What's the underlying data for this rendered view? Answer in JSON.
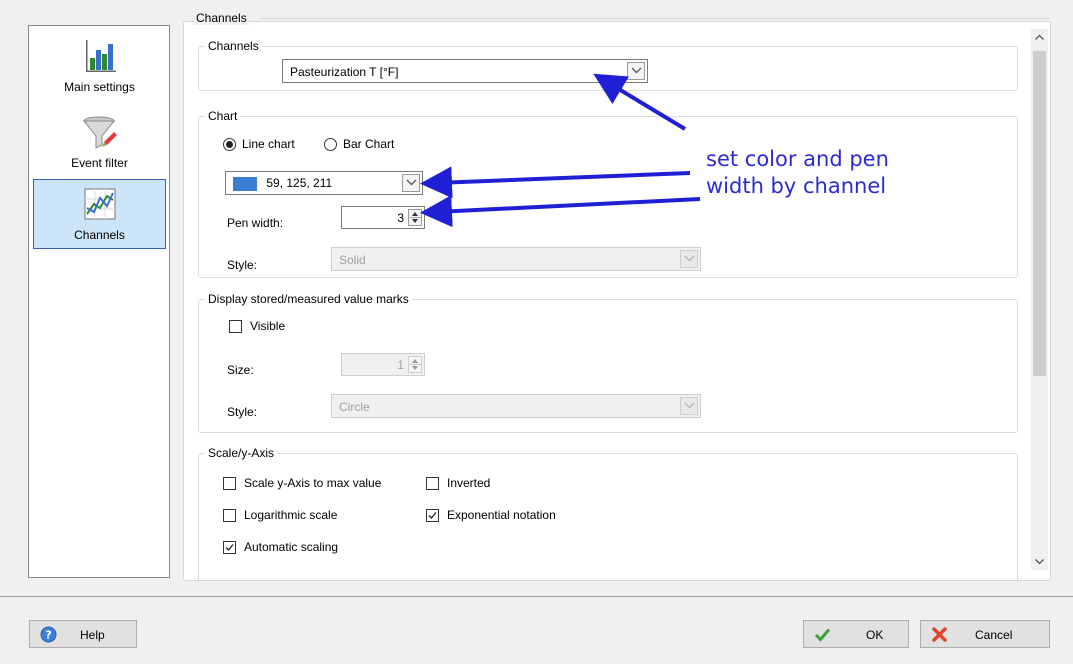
{
  "sidebar": {
    "items": [
      {
        "label": "Main settings",
        "icon": "bar-chart-icon"
      },
      {
        "label": "Event filter",
        "icon": "funnel-icon"
      },
      {
        "label": "Channels",
        "icon": "line-chart-icon",
        "selected": true
      }
    ]
  },
  "page": {
    "title": "Channels"
  },
  "channels_group": {
    "title": "Channels",
    "selected_channel": "Pasteurization T [°F]"
  },
  "chart_group": {
    "title": "Chart",
    "line_chart_label": "Line chart",
    "bar_chart_label": "Bar Chart",
    "line_chart_selected": true,
    "color_value": "59, 125, 211",
    "color_hex": "#3b7dd3",
    "pen_width_label": "Pen width:",
    "pen_width_value": "3",
    "style_label": "Style:",
    "style_value": "Solid"
  },
  "marks_group": {
    "title": "Display stored/measured value marks",
    "visible_label": "Visible",
    "visible_checked": false,
    "size_label": "Size:",
    "size_value": "1",
    "style_label": "Style:",
    "style_value": "Circle"
  },
  "scale_group": {
    "title": "Scale/y-Axis",
    "scale_to_max_label": "Scale y-Axis to max value",
    "inverted_label": "Inverted",
    "logarithmic_label": "Logarithmic scale",
    "exponential_label": "Exponential notation",
    "automatic_label": "Automatic scaling",
    "scale_to_max_checked": false,
    "inverted_checked": false,
    "logarithmic_checked": false,
    "exponential_checked": true,
    "automatic_checked": true
  },
  "annotation": {
    "line1": "set color and pen",
    "line2": "width by channel",
    "color": "#2b2bd6"
  },
  "footer": {
    "help_label": "Help",
    "ok_label": "OK",
    "cancel_label": "Cancel"
  }
}
